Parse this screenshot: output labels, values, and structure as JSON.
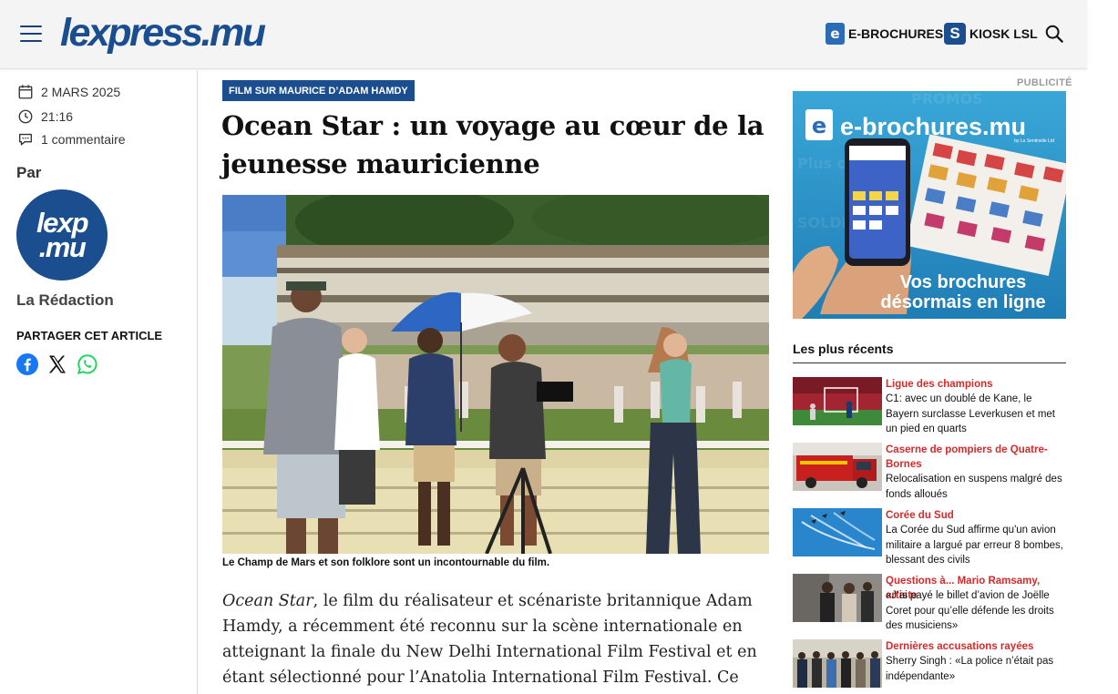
{
  "header": {
    "logo": "lexpress.mu",
    "ebrochures_label": "E-BROCHURES",
    "kiosk_label": "KIOSK LSL"
  },
  "meta": {
    "date": "2 MARS 2025",
    "time": "21:16",
    "comments": "1 commentaire",
    "by_label": "Par",
    "avatar_line1": "lexp",
    "avatar_line2": ".mu",
    "author": "La Rédaction",
    "share_title": "PARTAGER CET ARTICLE"
  },
  "article": {
    "kicker": "FILM SUR MAURICE D’ADAM HAMDY",
    "title": "Ocean Star : un voyage au cœur de la jeunesse mauricienne",
    "caption": "Le Champ de Mars et son folklore sont un incontournable du film.",
    "body_em": "Ocean Star",
    "body_rest": ", le film du réalisateur et scénariste britannique Adam Hamdy, a récemment été reconnu sur la scène internationale en atteignant la finale du New Delhi International Film Festival et en étant sélectionné pour l’Anatolia International Film Festival. Ce"
  },
  "ad": {
    "label": "PUBLICITÉ",
    "brand": "e-brochures.mu",
    "brand_sub": "by La Sentinelle Ltd",
    "tagline_1": "Vos brochures",
    "tagline_2": "désormais en ligne"
  },
  "recent": {
    "title": "Les plus récents",
    "items": [
      {
        "category": "Ligue des champions",
        "text": "C1: avec un doublé de Kane, le Bayern surclasse Leverkusen et met un pied en quarts"
      },
      {
        "category": "Caserne de pompiers de Quatre-Bornes",
        "text": "Relocalisation en suspens malgré des fonds alloués"
      },
      {
        "category": "Corée du Sud",
        "text": "La Corée du Sud affirme qu'un avion militaire a largué par erreur 8 bombes, blessant des civils"
      },
      {
        "category": "Questions à... Mario Ramsamy, artiste",
        "text": "«J’ai payé le billet d’avion de Joëlle Coret pour qu’elle défende les droits des musiciens»"
      },
      {
        "category": "Dernières accusations rayées",
        "text": "Sherry Singh : «La police n’était pas indépendante»"
      }
    ]
  },
  "colors": {
    "brand_blue": "#1a4e8f",
    "accent_red": "#d32a2a",
    "ad_blue": "#2f95c9"
  }
}
